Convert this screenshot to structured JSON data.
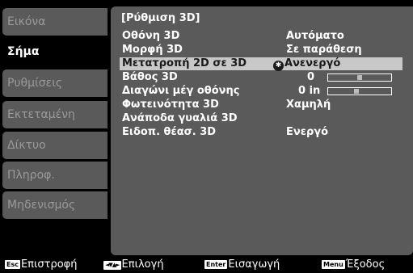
{
  "sidebar": {
    "items": [
      {
        "label": "Εικόνα"
      },
      {
        "label": "Σήμα",
        "active": true
      },
      {
        "label": "Ρυθμίσεις"
      },
      {
        "label": "Εκτεταμένη"
      },
      {
        "label": "Δίκτυο"
      },
      {
        "label": "Πληροφ."
      },
      {
        "label": "Μηδενισμός"
      }
    ]
  },
  "panel": {
    "title": "[Ρύθμιση 3D]",
    "rows": [
      {
        "label": "Οθόνη 3D",
        "value": "Αυτόματο"
      },
      {
        "label": "Μορφή 3D",
        "value": "Σε παράθεση"
      },
      {
        "label": "Μετατροπή 2D σε 3D",
        "value": "Ανενεργό",
        "selected": true
      },
      {
        "label": "Βάθος 3D",
        "value": "0",
        "slider_level": 0.5
      },
      {
        "label": "Διαγώνι μέγ οθόνης",
        "value": "0 in",
        "slider_level": 0.45
      },
      {
        "label": "Φωτεινότητα 3D",
        "value": "Χαμηλή"
      },
      {
        "label": "Ανάποδα γυαλιά 3D",
        "value": ""
      },
      {
        "label": "Ειδοπ. θέασ. 3D",
        "value": "Ενεργό"
      }
    ]
  },
  "footer": {
    "back": {
      "key": "Esc",
      "label": "Επιστροφή"
    },
    "select": {
      "key": "◄▼▲►",
      "label": "Επιλογή"
    },
    "enter": {
      "key": "Enter",
      "label": "Εισαγωγή"
    },
    "exit": {
      "key": "Menu",
      "label": "Έξοδος"
    }
  }
}
